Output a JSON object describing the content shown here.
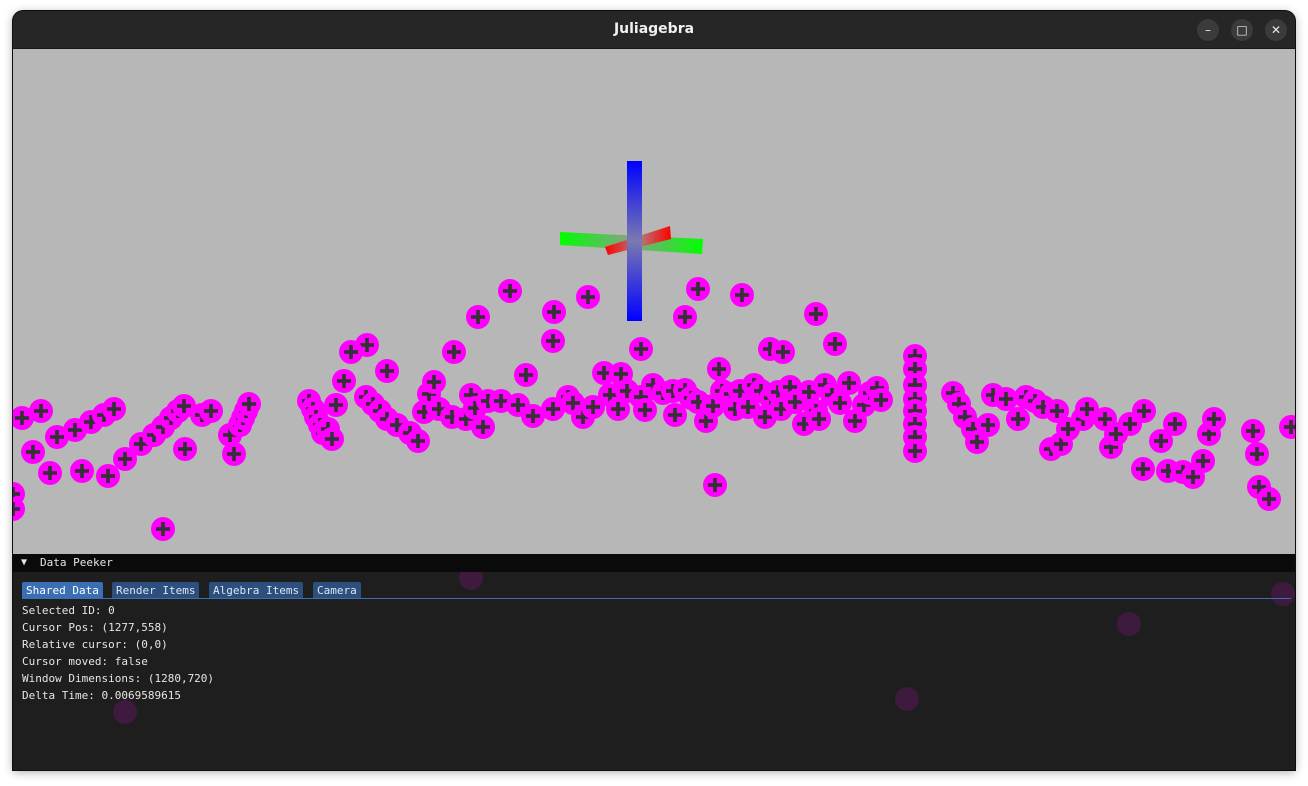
{
  "window": {
    "title": "Juliagebra",
    "minimize_glyph": "–",
    "maximize_glyph": "□",
    "close_glyph": "✕"
  },
  "scene": {
    "background_color": "#b7b7b7",
    "point_color": "#ff00ff",
    "marker_color": "#333333",
    "axis_colors": {
      "x": "#ff0000",
      "y": "#00ff00",
      "z": "#0000ff"
    }
  },
  "data_peeker": {
    "toggle_glyph": "▼",
    "title": "Data Peeker",
    "tabs": [
      "Shared Data",
      "Render Items",
      "Algebra Items",
      "Camera"
    ],
    "active_tab": "Shared Data",
    "shared_data": {
      "selected_id": "Selected ID: 0",
      "cursor_pos": "Cursor Pos: (1277,558)",
      "relative_cursor": "Relative cursor: (0,0)",
      "cursor_moved": "Cursor moved: false",
      "window_dimensions": "Window Dimensions: (1280,720)",
      "delta_time": "Delta Time: 0.0069589615"
    }
  }
}
